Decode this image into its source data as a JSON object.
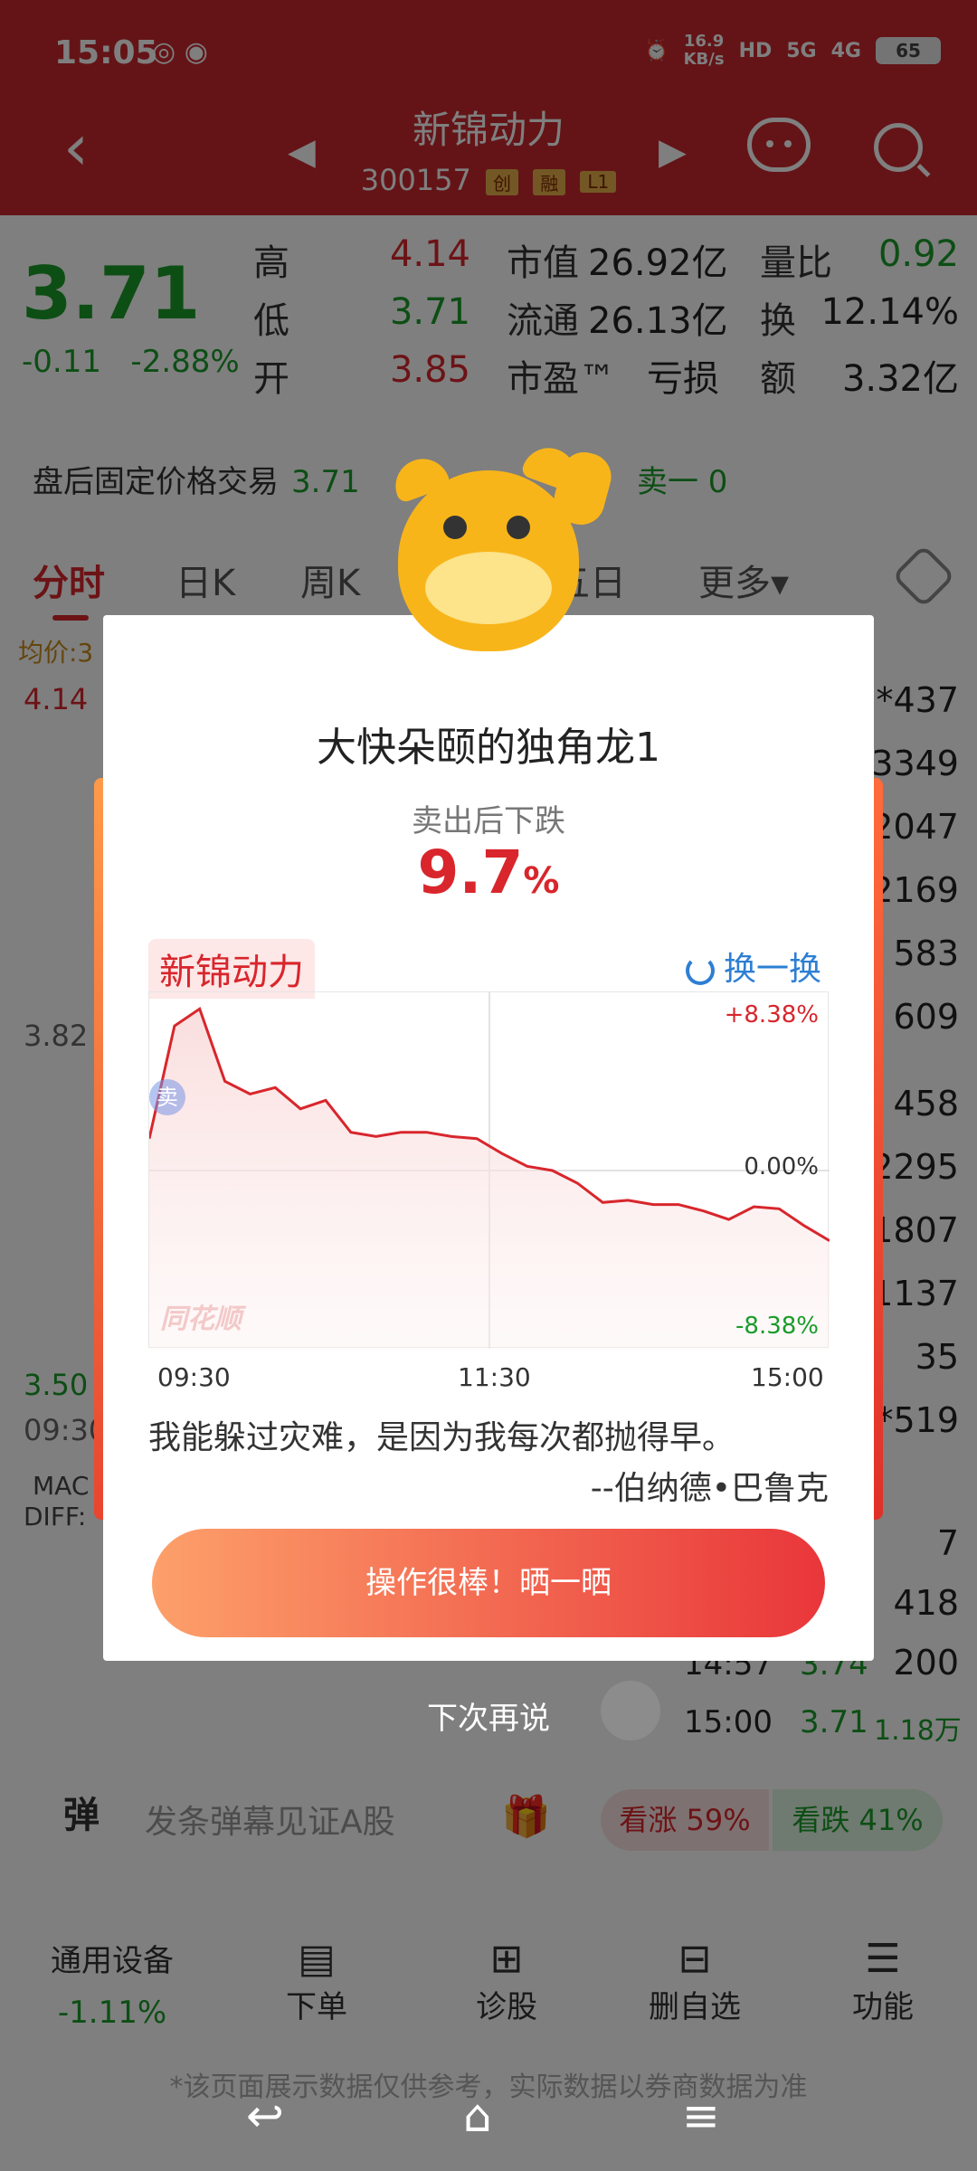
{
  "status": {
    "time": "15:05",
    "net_speed_value": "16.9",
    "net_speed_unit": "KB/s",
    "hd": "HD",
    "sig1": "5G",
    "sig2": "4G",
    "battery": "65"
  },
  "header": {
    "stock_name": "新锦动力",
    "stock_code": "300157",
    "tags": [
      "创",
      "融",
      "L1"
    ]
  },
  "quote": {
    "price": "3.71",
    "change": "-0.11",
    "change_pct": "-2.88%",
    "rows": [
      {
        "l1": "高",
        "v1": "4.14",
        "l2": "市值",
        "v2": "26.92亿",
        "l3": "量比",
        "v3": "0.92"
      },
      {
        "l1": "低",
        "v1": "3.71",
        "l2": "流通",
        "v2": "26.13亿",
        "l3": "换",
        "v3": "12.14%"
      },
      {
        "l1": "开",
        "v1": "3.85",
        "l2": "市盈™",
        "v2": "亏损",
        "l3": "额",
        "v3": "3.32亿"
      }
    ],
    "after_hours_label": "盘后固定价格交易",
    "after_hours_price": "3.71",
    "sell1": "卖一 0"
  },
  "tabs": [
    "分时",
    "日K",
    "周K",
    "五日",
    "更多▾"
  ],
  "background": {
    "avg_label": "均价:3",
    "high": "4.14",
    "mid": "3.82",
    "low": "3.50",
    "time0930": "09:30",
    "macd": "MAC",
    "diff": "DIFF:",
    "right_values": [
      "*437",
      "3349",
      "2047",
      "2169",
      "583",
      "609",
      "458",
      "2295",
      "1807",
      "1137",
      "35",
      "*519",
      "7",
      "418",
      "200"
    ],
    "tick1_time": "14:57",
    "tick1_price": "3.74",
    "tick2_time": "15:00",
    "tick2_price": "3.71",
    "tick2_vol": "1.18万"
  },
  "danmu": {
    "label": "弹",
    "placeholder": "发条弹幕见证A股",
    "rise": "看涨 59%",
    "fall": "看跌 41%"
  },
  "bottom_nav": {
    "sector": "通用设备",
    "sector_change": "-1.11%",
    "items": [
      "下单",
      "诊股",
      "删自选",
      "功能"
    ]
  },
  "disclaimer": "*该页面展示数据仅供参考，实际数据以券商数据为准",
  "dialog": {
    "title": "大快朵颐的独角龙1",
    "subtitle": "卖出后下跌",
    "pct_value": "9.7",
    "pct_unit": "%",
    "stock_name": "新锦动力",
    "swap_label": "换一换",
    "chart_top": "+8.38%",
    "chart_mid": "0.00%",
    "chart_bot": "-8.38%",
    "sell_marker": "卖",
    "watermark": "同花顺",
    "x_ticks": [
      "09:30",
      "11:30",
      "15:00"
    ],
    "quote": "我能躲过灾难，是因为我每次都抛得早。",
    "author": "--伯纳德•巴鲁克",
    "share_button": "操作很棒！晒一晒",
    "later": "下次再说"
  },
  "chart_data": {
    "type": "line",
    "title": "",
    "x": [
      "09:30",
      "11:30",
      "15:00"
    ],
    "ylim": [
      -8.38,
      8.38
    ],
    "series": [
      {
        "values": [
          1.5,
          6.8,
          7.6,
          4.2,
          3.6,
          3.9,
          2.9,
          3.3,
          1.8,
          1.6,
          1.8,
          1.8,
          1.6,
          1.5,
          0.8,
          0.2,
          0.0,
          -0.6,
          -1.5,
          -1.4,
          -1.6,
          -1.6,
          -1.9,
          -2.3,
          -1.7,
          -1.8,
          -2.6,
          -3.3
        ]
      }
    ]
  }
}
